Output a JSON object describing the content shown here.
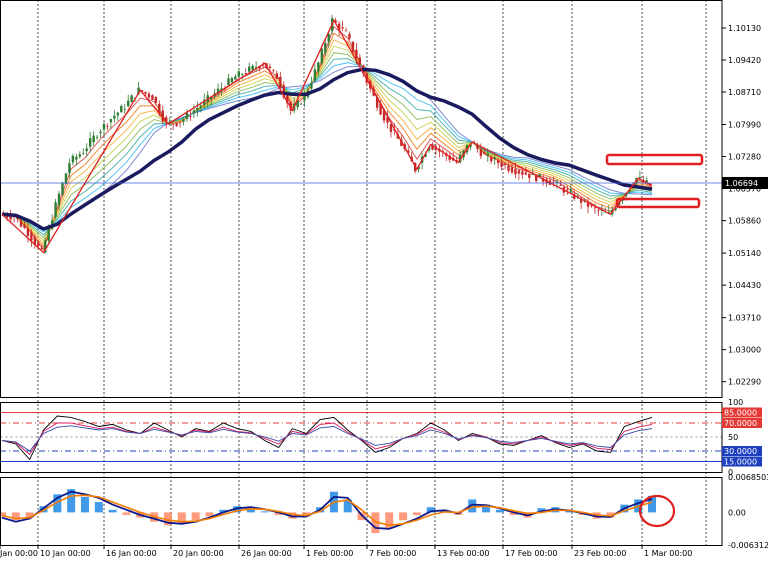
{
  "colors": {
    "ma_long": "#1a1a5e",
    "zigzag": "#e02020",
    "bull_candle": "#2e7d32",
    "bear_candle": "#c62828",
    "rsi_lines": [
      "#000000",
      "#d81b60",
      "#3949ab"
    ],
    "macd_pos": "#1e88e5",
    "macd_neg": "#ff8a65",
    "macd_line": "#0d1a8c",
    "signal_line": "#f57c00",
    "level_high": "#e53935",
    "level_low": "#1e40c0",
    "price_line": "#3b5bdb"
  },
  "chart_data": [
    {
      "type": "line",
      "title": "",
      "x_ticks": [
        "Jan 00:00",
        "10 Jan 00:00",
        "16 Jan 00:00",
        "20 Jan 00:00",
        "26 Jan 00:00",
        "1 Feb 00:00",
        "7 Feb 00:00",
        "13 Feb 00:00",
        "17 Feb 00:00",
        "23 Feb 00:00",
        "1 Mar 00:00"
      ],
      "y_ticks": [
        "1.10130",
        "1.09420",
        "1.08710",
        "1.07990",
        "1.07280",
        "1.06570",
        "1.05860",
        "1.05140",
        "1.04430",
        "1.03710",
        "1.03000",
        "1.02290"
      ],
      "ylim": [
        1.0195,
        1.1075
      ],
      "current_price_label": "1.06694",
      "current_price": 1.06694,
      "series": [
        {
          "values": [
            1.06,
            1.0595,
            1.056,
            1.0515,
            1.062,
            1.0715,
            1.074,
            1.078,
            1.0812,
            1.084,
            1.0875,
            1.086,
            1.08,
            1.0805,
            1.083,
            1.0855,
            1.088,
            1.0905,
            1.092,
            1.0935,
            1.0905,
            1.083,
            1.086,
            1.0935,
            1.103,
            1.1,
            1.093,
            1.086,
            1.08,
            1.0755,
            1.07,
            1.0755,
            1.0735,
            1.0715,
            1.076,
            1.073,
            1.0715,
            1.07,
            1.069,
            1.068,
            1.067,
            1.065,
            1.063,
            1.061,
            1.06,
            1.064,
            1.068,
            1.0664
          ]
        }
      ]
    },
    {
      "type": "line",
      "title": "",
      "y_ticks": [
        "100",
        "50",
        "0"
      ],
      "ylim": [
        0,
        100
      ],
      "level_labels": [
        "85.0000",
        "70.0000",
        "30.0000",
        "15.0000"
      ],
      "levels": [
        85,
        70,
        30,
        15
      ],
      "series": [
        {
          "values": [
            45,
            40,
            18,
            60,
            80,
            78,
            72,
            65,
            68,
            60,
            55,
            70,
            60,
            50,
            62,
            58,
            70,
            62,
            58,
            45,
            35,
            62,
            55,
            75,
            78,
            60,
            45,
            28,
            35,
            48,
            55,
            70,
            60,
            45,
            55,
            50,
            40,
            38,
            45,
            52,
            42,
            35,
            40,
            30,
            28,
            65,
            72,
            78
          ]
        },
        {
          "values": [
            45,
            42,
            25,
            58,
            70,
            70,
            66,
            62,
            64,
            58,
            55,
            64,
            58,
            52,
            60,
            57,
            64,
            58,
            56,
            48,
            40,
            58,
            54,
            68,
            70,
            57,
            46,
            33,
            38,
            48,
            54,
            64,
            57,
            46,
            53,
            50,
            42,
            40,
            45,
            50,
            43,
            38,
            41,
            34,
            32,
            58,
            64,
            68
          ]
        },
        {
          "values": [
            45,
            43,
            30,
            55,
            64,
            66,
            63,
            60,
            62,
            57,
            55,
            61,
            57,
            53,
            58,
            56,
            61,
            57,
            55,
            50,
            44,
            55,
            53,
            63,
            65,
            55,
            47,
            38,
            41,
            48,
            52,
            60,
            55,
            47,
            52,
            49,
            44,
            42,
            45,
            48,
            44,
            40,
            42,
            37,
            35,
            53,
            59,
            62
          ]
        }
      ]
    },
    {
      "type": "bar",
      "title": "",
      "y_ticks": [
        "0.0068503",
        "0.00",
        "-0.0063126"
      ],
      "ylim": [
        -0.0063126,
        0.0068503
      ],
      "series": [
        {
          "values": [
            -0.0008,
            -0.0015,
            -0.001,
            0.0012,
            0.0035,
            0.0045,
            0.003,
            0.002,
            0.0005,
            -0.0005,
            -0.001,
            -0.0018,
            -0.0025,
            -0.0022,
            -0.0015,
            -0.0008,
            0.0005,
            0.0012,
            0.0008,
            0.0002,
            -0.0005,
            -0.0012,
            -0.0008,
            0.001,
            0.004,
            0.0025,
            -0.0015,
            -0.004,
            -0.003,
            -0.0015,
            -0.0005,
            0.001,
            0.0005,
            -0.0005,
            0.0025,
            0.0015,
            0.0005,
            -0.0005,
            -0.001,
            0.0008,
            0.001,
            0.0003,
            -0.0005,
            -0.0012,
            -0.001,
            0.0015,
            0.0025,
            0.0032
          ]
        },
        {
          "values": [
            -0.001,
            -0.0018,
            -0.0012,
            0.0008,
            0.0028,
            0.004,
            0.0035,
            0.0028,
            0.0015,
            0.0005,
            -0.0005,
            -0.0012,
            -0.002,
            -0.0022,
            -0.0018,
            -0.001,
            0.0,
            0.0008,
            0.001,
            0.0006,
            0.0,
            -0.0008,
            -0.0008,
            0.0005,
            0.003,
            0.0028,
            -0.0005,
            -0.003,
            -0.0032,
            -0.0022,
            -0.0012,
            0.0002,
            0.0004,
            -0.0002,
            0.0015,
            0.0014,
            0.0008,
            0.0,
            -0.0006,
            0.0002,
            0.0006,
            0.0004,
            -0.0002,
            -0.0008,
            -0.0009,
            0.0008,
            0.0018,
            0.0026
          ]
        },
        {
          "values": [
            -0.0006,
            -0.0012,
            -0.001,
            0.0004,
            0.002,
            0.0032,
            0.0033,
            0.003,
            0.002,
            0.001,
            0.0,
            -0.0008,
            -0.0015,
            -0.0018,
            -0.0017,
            -0.0012,
            -0.0004,
            0.0003,
            0.0007,
            0.0006,
            0.0002,
            -0.0004,
            -0.0006,
            0.0002,
            0.002,
            0.0024,
            0.0005,
            -0.0018,
            -0.0025,
            -0.0022,
            -0.0015,
            -0.0005,
            0.0001,
            0.0,
            0.001,
            0.0012,
            0.0009,
            0.0003,
            -0.0002,
            0.0,
            0.0004,
            0.0004,
            0.0,
            -0.0005,
            -0.0007,
            0.0003,
            0.0012,
            0.002
          ]
        }
      ]
    }
  ]
}
